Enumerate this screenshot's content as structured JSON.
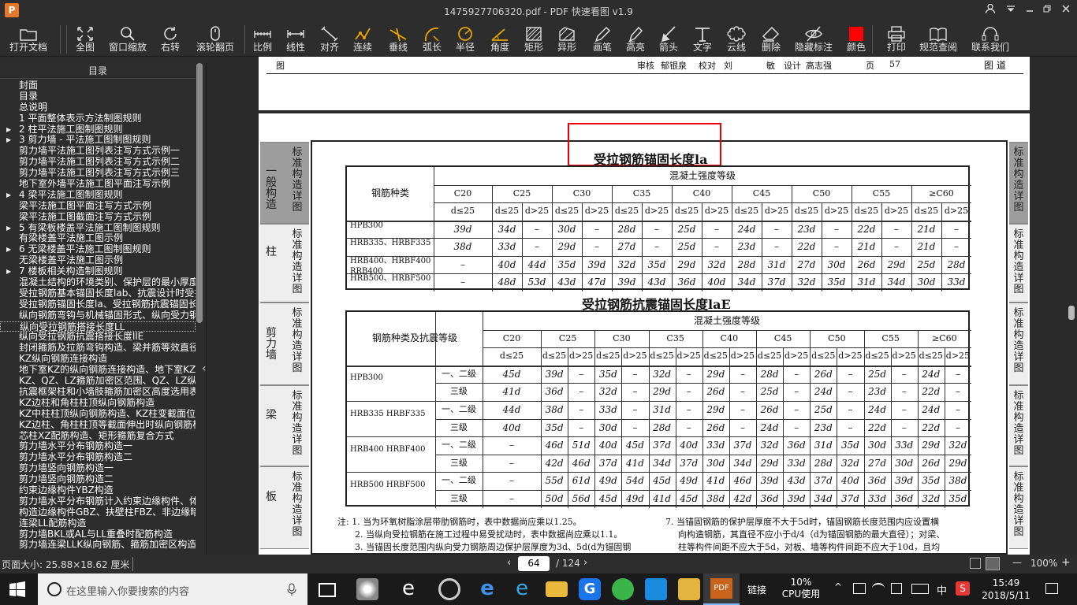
{
  "window": {
    "title": "1475927706320.pdf - PDF 快速看图 v1.9",
    "logo": "P"
  },
  "toolbar": {
    "items": [
      {
        "id": "open",
        "label": "打开文档",
        "icon": "folder-icon"
      },
      {
        "id": "fit",
        "label": "全图",
        "icon": "expand-icon"
      },
      {
        "id": "zoom",
        "label": "窗口缩放",
        "icon": "magnifier-icon"
      },
      {
        "id": "rotate",
        "label": "右转",
        "icon": "rotate-icon"
      },
      {
        "id": "scroll",
        "label": "滚轮翻页",
        "icon": "mouse-icon"
      },
      {
        "id": "scale",
        "label": "比例",
        "icon": "ruler-icon"
      },
      {
        "id": "line",
        "label": "线性",
        "icon": "line-measure-icon"
      },
      {
        "id": "align",
        "label": "对齐",
        "icon": "align-icon"
      },
      {
        "id": "cont",
        "label": "连续",
        "icon": "continuous-icon"
      },
      {
        "id": "perp",
        "label": "垂线",
        "icon": "perpendicular-icon"
      },
      {
        "id": "arc",
        "label": "弧长",
        "icon": "arc-icon"
      },
      {
        "id": "radius",
        "label": "半径",
        "icon": "radius-icon"
      },
      {
        "id": "angle",
        "label": "角度",
        "icon": "angle-icon"
      },
      {
        "id": "rect",
        "label": "矩形",
        "icon": "rectangle-icon"
      },
      {
        "id": "shape",
        "label": "异形",
        "icon": "polygon-icon"
      },
      {
        "id": "pen",
        "label": "画笔",
        "icon": "pen-icon"
      },
      {
        "id": "hl",
        "label": "高亮",
        "icon": "highlighter-icon"
      },
      {
        "id": "arrow",
        "label": "箭头",
        "icon": "arrow-icon"
      },
      {
        "id": "text",
        "label": "文字",
        "icon": "text-icon"
      },
      {
        "id": "cloud",
        "label": "云线",
        "icon": "cloud-icon"
      },
      {
        "id": "del",
        "label": "删除",
        "icon": "eraser-icon"
      },
      {
        "id": "hide",
        "label": "隐藏标注",
        "icon": "eye-hidden-icon"
      },
      {
        "id": "color",
        "label": "颜色",
        "icon": "color-swatch-icon"
      },
      {
        "id": "print",
        "label": "打印",
        "icon": "printer-icon"
      },
      {
        "id": "spec",
        "label": "规范查阅",
        "icon": "book-icon"
      },
      {
        "id": "contact",
        "label": "联系我们",
        "icon": "headset-icon"
      }
    ],
    "color_value": "#ff0000"
  },
  "toc": {
    "title": "目录",
    "items": [
      {
        "t": "封面",
        "a": false
      },
      {
        "t": "目录",
        "a": false
      },
      {
        "t": "总说明",
        "a": false
      },
      {
        "t": "1  平面整体表示方法制图规则",
        "a": false
      },
      {
        "t": "2  柱平法施工图制图规则",
        "a": true
      },
      {
        "t": "3  剪力墙 - 平法施工图制图规则",
        "a": true
      },
      {
        "t": "剪力墙平法施工图列表注写方式示例一",
        "a": false
      },
      {
        "t": "剪力墙平法施工图列表注写方式示例二",
        "a": false
      },
      {
        "t": "剪力墙平法施工图列表注写方式示例三",
        "a": false
      },
      {
        "t": "地下室外墙平法施工图平面注写示例",
        "a": false
      },
      {
        "t": "4  梁平法施工图制图规则",
        "a": true
      },
      {
        "t": "梁平法施工图平面注写方式示例",
        "a": false
      },
      {
        "t": "梁平法施工图截面注写方式示例",
        "a": false
      },
      {
        "t": "5  有梁板楼盖平法施工图制图规则",
        "a": true
      },
      {
        "t": "有梁楼盖平法施工图示例",
        "a": false
      },
      {
        "t": "6  无梁楼盖平法施工图制图规则",
        "a": true
      },
      {
        "t": "无梁楼盖平法施工图示例",
        "a": false
      },
      {
        "t": "7  楼板相关构造制图规则",
        "a": true
      },
      {
        "t": "混凝土结构的环境类别、保护层的最小厚度",
        "a": false
      },
      {
        "t": "受拉钢筋基本锚固长度lab、抗震设计时受拉",
        "a": false
      },
      {
        "t": "受拉钢筋锚固长度la、受拉钢筋抗震锚固长",
        "a": false
      },
      {
        "t": "纵向钢筋弯钩与机械锚固形式、纵向受力钢",
        "a": false
      },
      {
        "t": "纵向受拉钢筋搭接长度LL",
        "a": false
      },
      {
        "t": "纵向受拉钢筋抗震搭接长度llE",
        "a": false
      },
      {
        "t": "封闭箍筋及拉筋弯钩构造、梁并筋等效直径",
        "a": false
      },
      {
        "t": "KZ纵向钢筋连接构造",
        "a": false
      },
      {
        "t": "地下室KZ的纵向钢筋连接构造、地下室KZ的",
        "a": false
      },
      {
        "t": "KZ、QZ、LZ箍筋加密区范围、QZ、LZ纵向钢",
        "a": false
      },
      {
        "t": "抗震框架柱和小墙肢箍筋加密区高度选用表",
        "a": false
      },
      {
        "t": "KZ边柱和角柱柱顶纵向钢筋构造",
        "a": false
      },
      {
        "t": "KZ中柱柱顶纵向钢筋构造、KZ柱变截面位置",
        "a": false
      },
      {
        "t": "KZ边柱、角柱柱顶等截面伸出时纵向钢筋构",
        "a": false
      },
      {
        "t": "芯柱XZ配筋构造、矩形箍筋复合方式",
        "a": false
      },
      {
        "t": "剪力墙水平分布钢筋构造一",
        "a": false
      },
      {
        "t": "剪力墙水平分布钢筋构造二",
        "a": false
      },
      {
        "t": "剪力墙竖向钢筋构造一",
        "a": false
      },
      {
        "t": "剪力墙竖向钢筋构造二",
        "a": false
      },
      {
        "t": "约束边缘构件YBZ构造",
        "a": false
      },
      {
        "t": "剪力墙水平分布钢筋计入约束边缘构件、体",
        "a": false
      },
      {
        "t": "构造边缘构件GBZ、扶壁柱FBZ、非边缘暗柱",
        "a": false
      },
      {
        "t": "连梁LL配筋构造",
        "a": false
      },
      {
        "t": "剪力墙BKL或AL与LL重叠时配筋构造",
        "a": false
      },
      {
        "t": "剪力墙连梁LLK纵向钢筋、箍筋加密区构造",
        "a": false
      }
    ],
    "selected_index": 22
  },
  "page_top": {
    "row": [
      "图",
      "审核",
      "郁银泉",
      "校对",
      "刘",
      "敏",
      "设计",
      "高志强",
      "页",
      "57"
    ],
    "right_label": "图 道"
  },
  "page": {
    "title": "受拉钢筋锚固长度la",
    "title2": "受拉钢筋抗震锚固长度laE",
    "left_strips": [
      {
        "t": "一般构造",
        "s": "标准构造详图",
        "dark": true
      },
      {
        "t": "柱",
        "s": "标准构造详图",
        "dark": false
      },
      {
        "t": "剪力墙",
        "s": "标准构造详图",
        "dark": false
      },
      {
        "t": "梁",
        "s": "标准构造详图",
        "dark": false
      },
      {
        "t": "板",
        "s": "标准构造详图",
        "dark": false
      }
    ],
    "right_strips": [
      "标准构造详图",
      "标准构造详图",
      "标准构造详图",
      "标准构造详图",
      "标准构造详图"
    ],
    "t1": {
      "rowhead": "钢筋种类",
      "group": "混凝土强度等级",
      "grades": [
        "C20",
        "C25",
        "C30",
        "C35",
        "C40",
        "C45",
        "C50",
        "C55",
        "≥C60"
      ],
      "sub20": "d≤25",
      "subA": "d≤25",
      "subB": "d>25",
      "rows": [
        {
          "k": "HPB300",
          "v": [
            "39d",
            "34d",
            "–",
            "30d",
            "–",
            "28d",
            "–",
            "25d",
            "–",
            "24d",
            "–",
            "23d",
            "–",
            "22d",
            "–",
            "21d",
            "–"
          ]
        },
        {
          "k": "HRB335、HRBF335",
          "v": [
            "38d",
            "33d",
            "–",
            "29d",
            "–",
            "27d",
            "–",
            "25d",
            "–",
            "23d",
            "–",
            "22d",
            "–",
            "21d",
            "–",
            "21d",
            "–"
          ]
        },
        {
          "k": "HRB400、HRBF400 RRB400",
          "v": [
            "–",
            "40d",
            "44d",
            "35d",
            "39d",
            "32d",
            "35d",
            "29d",
            "32d",
            "28d",
            "31d",
            "27d",
            "30d",
            "26d",
            "29d",
            "25d",
            "28d"
          ]
        },
        {
          "k": "HRB500、HRBF500",
          "v": [
            "–",
            "48d",
            "53d",
            "43d",
            "47d",
            "39d",
            "43d",
            "36d",
            "40d",
            "34d",
            "37d",
            "32d",
            "35d",
            "31d",
            "34d",
            "30d",
            "33d"
          ]
        }
      ]
    },
    "t2": {
      "rowhead": "钢筋种类及抗震等级",
      "group": "混凝土强度等级",
      "grades": [
        "C20",
        "C25",
        "C30",
        "C35",
        "C40",
        "C45",
        "C50",
        "C55",
        "≥C60"
      ],
      "sub20": "d≤25",
      "subA": "d≤25",
      "subB": "d>25",
      "rows": [
        {
          "k": "HPB300",
          "g": "一、二级",
          "v": [
            "45d",
            "39d",
            "–",
            "35d",
            "–",
            "32d",
            "–",
            "29d",
            "–",
            "28d",
            "–",
            "26d",
            "–",
            "25d",
            "–",
            "24d",
            "–"
          ]
        },
        {
          "k": "",
          "g": "三级",
          "v": [
            "41d",
            "36d",
            "–",
            "32d",
            "–",
            "29d",
            "–",
            "26d",
            "–",
            "25d",
            "–",
            "24d",
            "–",
            "23d",
            "–",
            "22d",
            "–"
          ]
        },
        {
          "k": "HRB335 HRBF335",
          "g": "一、二级",
          "v": [
            "44d",
            "38d",
            "–",
            "33d",
            "–",
            "31d",
            "–",
            "29d",
            "–",
            "26d",
            "–",
            "25d",
            "–",
            "24d",
            "–",
            "24d",
            "–"
          ]
        },
        {
          "k": "",
          "g": "三级",
          "v": [
            "40d",
            "35d",
            "–",
            "30d",
            "–",
            "28d",
            "–",
            "26d",
            "–",
            "24d",
            "–",
            "23d",
            "–",
            "22d",
            "–",
            "22d",
            "–"
          ]
        },
        {
          "k": "HRB400 HRBF400",
          "g": "一、二级",
          "v": [
            "–",
            "46d",
            "51d",
            "40d",
            "45d",
            "37d",
            "40d",
            "33d",
            "37d",
            "32d",
            "36d",
            "31d",
            "35d",
            "30d",
            "33d",
            "29d",
            "32d"
          ]
        },
        {
          "k": "",
          "g": "三级",
          "v": [
            "–",
            "42d",
            "46d",
            "37d",
            "41d",
            "34d",
            "37d",
            "30d",
            "34d",
            "29d",
            "33d",
            "28d",
            "32d",
            "27d",
            "30d",
            "26d",
            "29d"
          ]
        },
        {
          "k": "HRB500 HRBF500",
          "g": "一、二级",
          "v": [
            "–",
            "55d",
            "61d",
            "49d",
            "54d",
            "45d",
            "49d",
            "41d",
            "46d",
            "39d",
            "43d",
            "37d",
            "40d",
            "36d",
            "39d",
            "35d",
            "38d"
          ]
        },
        {
          "k": "",
          "g": "三级",
          "v": [
            "–",
            "50d",
            "56d",
            "45d",
            "49d",
            "41d",
            "45d",
            "38d",
            "42d",
            "36d",
            "39d",
            "34d",
            "37d",
            "33d",
            "36d",
            "32d",
            "35d"
          ]
        }
      ]
    },
    "notes_left": [
      "注: 1. 当为环氧树脂涂层带肋钢筋时，表中数据尚应乘以1.25。",
      "2. 当纵向受拉钢筋在施工过程中易受扰动时，表中数据尚应乘以1.1。",
      "3. 当锚固长度范围内纵向受力钢筋周边保护层厚度为3d、5d(d为锚固钢"
    ],
    "notes_right": [
      "7. 当锚固钢筋的保护层厚度不大于5d时，锚固钢筋长度范围内应设置横",
      "向构造钢筋，其直径不应小于d/4（d为锚固钢筋的最大直径）；对梁、",
      "柱等构件间距不应大于5d，对板、墙等构件间距不应大于10d，且均"
    ]
  },
  "status": {
    "page_size": "页面大小: 25.88×18.62 厘米",
    "page_current": "64",
    "page_total": "/ 124",
    "zoom": "100%"
  },
  "taskbar": {
    "search_placeholder": "在这里输入你要搜索的内容",
    "link_label": "链接",
    "cpu_pct": "10%",
    "cpu_label": "CPU使用",
    "ime": "中",
    "time": "15:49",
    "date": "2018/5/11"
  }
}
